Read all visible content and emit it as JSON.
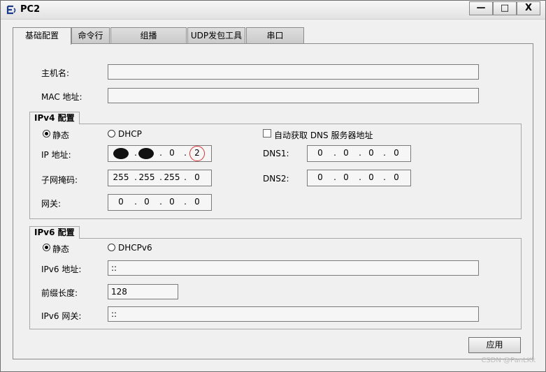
{
  "window": {
    "title": "PC2",
    "minimize": "—",
    "maximize": "□",
    "close": "X"
  },
  "tabs": [
    {
      "label": "基础配置",
      "active": true
    },
    {
      "label": "命令行"
    },
    {
      "label": "组播"
    },
    {
      "label": "UDP发包工具"
    },
    {
      "label": "串口"
    }
  ],
  "basic": {
    "hostname_label": "主机名:",
    "hostname_value": "",
    "mac_label": "MAC 地址:",
    "mac_value": ""
  },
  "ipv4": {
    "title": "IPv4 配置",
    "static_label": "静态",
    "dhcp_label": "DHCP",
    "auto_dns_label": "自动获取 DNS 服务器地址",
    "ip_label": "IP 地址:",
    "ip_octets": [
      "",
      "",
      "0",
      "2"
    ],
    "mask_label": "子网掩码:",
    "mask_octets": [
      "255",
      "255",
      "255",
      "0"
    ],
    "gateway_label": "网关:",
    "gateway_octets": [
      "0",
      "0",
      "0",
      "0"
    ],
    "dns1_label": "DNS1:",
    "dns1_octets": [
      "0",
      "0",
      "0",
      "0"
    ],
    "dns2_label": "DNS2:",
    "dns2_octets": [
      "0",
      "0",
      "0",
      "0"
    ]
  },
  "ipv6": {
    "title": "IPv6 配置",
    "static_label": "静态",
    "dhcp_label": "DHCPv6",
    "addr_label": "IPv6 地址:",
    "addr_value": "::",
    "prefix_label": "前缀长度:",
    "prefix_value": "128",
    "gateway_label": "IPv6 网关:",
    "gateway_value": "::"
  },
  "apply_label": "应用",
  "watermark": "CSDN @PanLKk"
}
